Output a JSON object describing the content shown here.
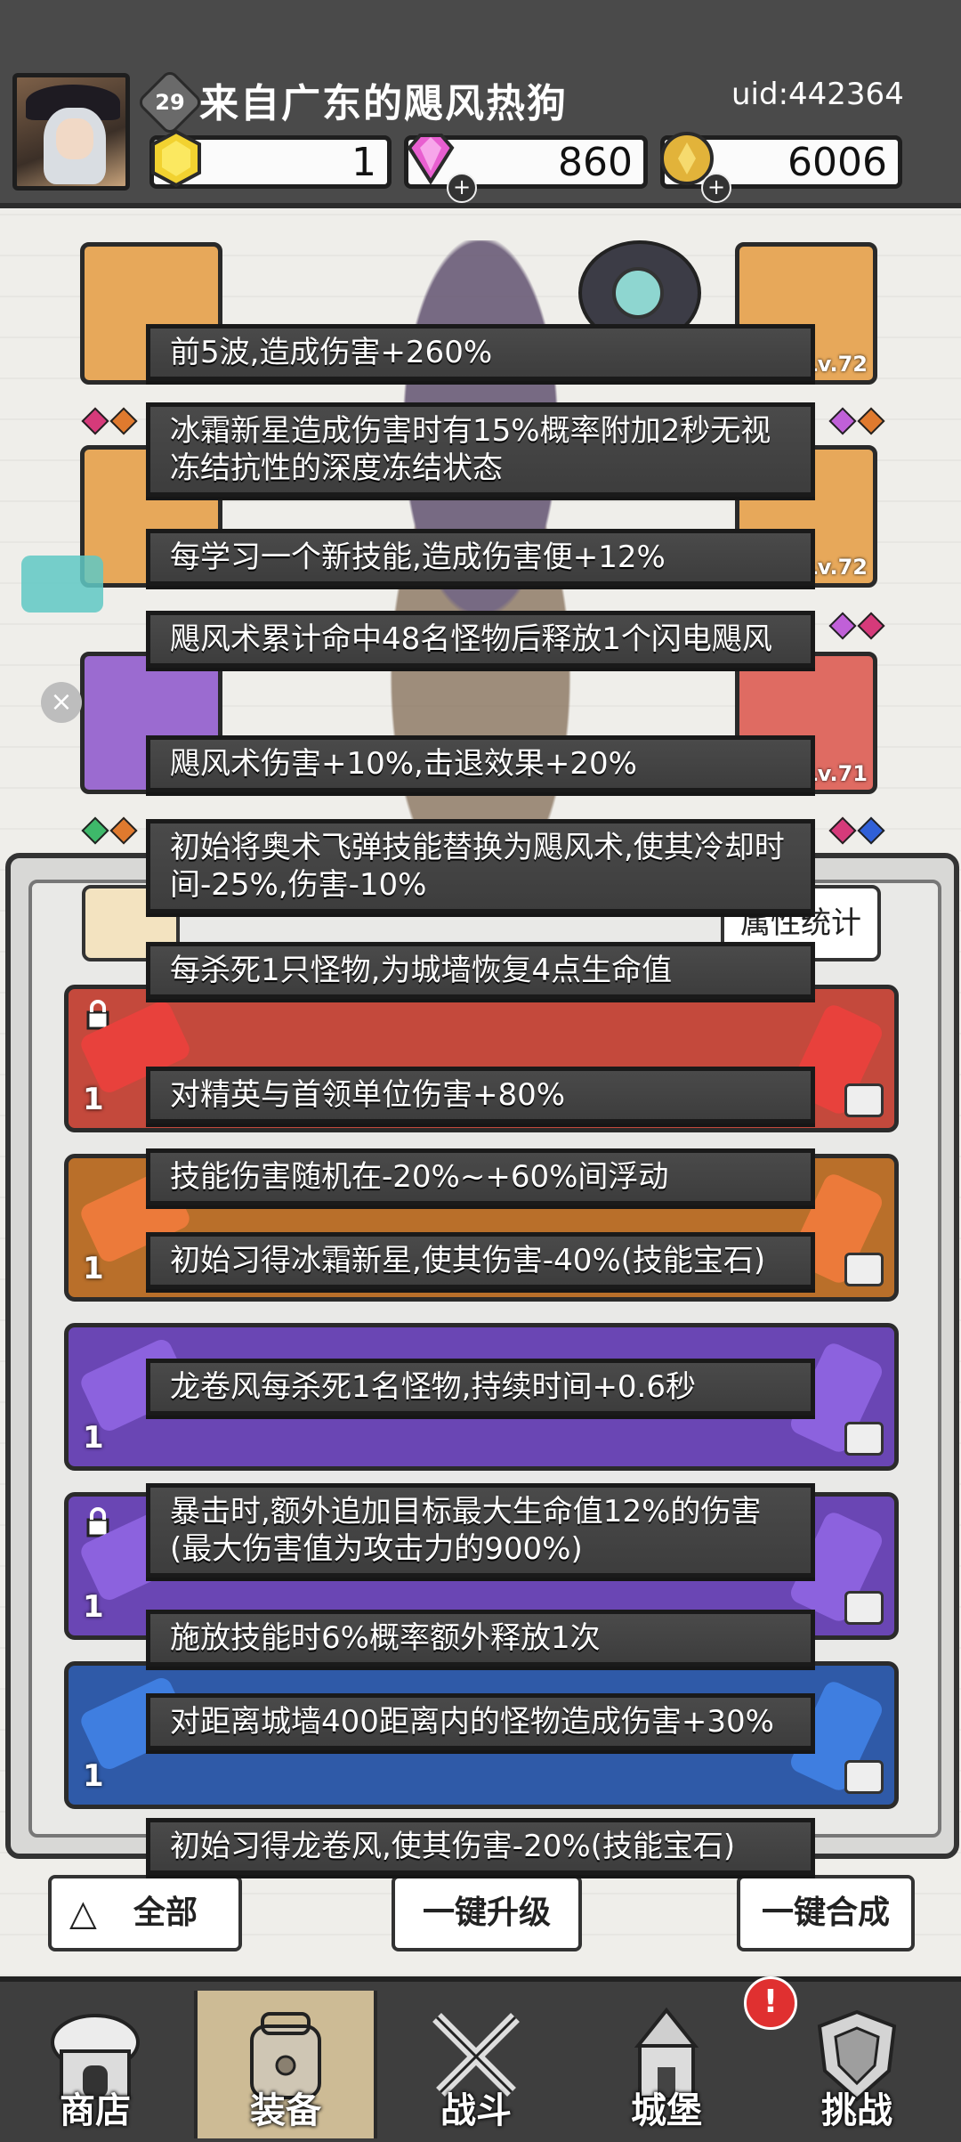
{
  "header": {
    "level": "29",
    "player_name": "来自广东的飓风热狗",
    "uid": "uid:442364",
    "resources": [
      {
        "name": "gold-gem",
        "value": "1"
      },
      {
        "name": "diamond",
        "value": "860"
      },
      {
        "name": "coin",
        "value": "6006"
      }
    ]
  },
  "scene": {
    "slot_levels": [
      "Lv.72",
      "Lv.72",
      "Lv.71"
    ],
    "tab_right_label": "属性统计",
    "row_counts": [
      "1",
      "1",
      "1",
      "1",
      "1"
    ]
  },
  "tooltips": [
    "前5波,造成伤害+260%",
    "冰霜新星造成伤害时有15%概率附加2秒无视冻结抗性的深度冻结状态",
    "每学习一个新技能,造成伤害便+12%",
    "飓风术累计命中48名怪物后释放1个闪电飓风",
    "飓风术伤害+10%,击退效果+20%",
    "初始将奥术飞弹技能替换为飓风术,使其冷却时间-25%,伤害-10%",
    "每杀死1只怪物,为城墙恢复4点生命值",
    "对精英与首领单位伤害+80%",
    "技能伤害随机在-20%~+60%间浮动",
    "初始习得冰霜新星,使其伤害-40%(技能宝石)",
    "龙卷风每杀死1名怪物,持续时间+0.6秒",
    "暴击时,额外追加目标最大生命值12%的伤害(最大伤害值为攻击力的900%)",
    "施放技能时6%概率额外释放1次",
    "对距离城墙400距离内的怪物造成伤害+30%",
    "初始习得龙卷风,使其伤害-20%(技能宝石)"
  ],
  "bottom_buttons": {
    "filter": "全部",
    "middle": "一键升级",
    "right": "一键合成"
  },
  "nav": [
    {
      "label": "商店",
      "icon": "shop-icon"
    },
    {
      "label": "装备",
      "icon": "backpack-icon"
    },
    {
      "label": "战斗",
      "icon": "crossed-swords-icon"
    },
    {
      "label": "城堡",
      "icon": "castle-icon"
    },
    {
      "label": "挑战",
      "icon": "shield-icon"
    }
  ],
  "nav_badge": "!",
  "colors": {
    "header_bg": "#4a4a4a",
    "tooltip_bg": "#444444",
    "nav_bg": "#3e3e3e",
    "nav_active": "#cdbb95"
  }
}
